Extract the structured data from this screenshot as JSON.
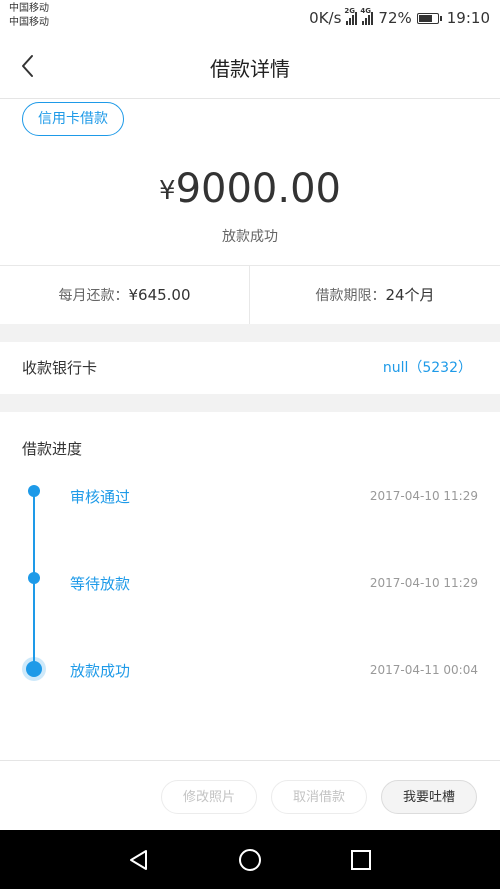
{
  "status_bar": {
    "carrier_1": "中国移动",
    "carrier_2": "中国移动",
    "net_speed": "0K/s",
    "network_1": "2G",
    "network_2": "4G",
    "battery": "72%",
    "battery_level": 0.72,
    "time": "19:10"
  },
  "nav": {
    "title": "借款详情"
  },
  "loan": {
    "tag": "信用卡借款",
    "currency": "¥",
    "amount": "9000.00",
    "status": "放款成功",
    "monthly_label": "每月还款：",
    "monthly_value": "¥645.00",
    "term_label": "借款期限：",
    "term_value": "24个月"
  },
  "bank": {
    "label": "收款银行卡",
    "value": "null（5232）"
  },
  "progress": {
    "title": "借款进度",
    "steps": [
      {
        "label": "审核通过",
        "time": "2017-04-10 11:29"
      },
      {
        "label": "等待放款",
        "time": "2017-04-10 11:29"
      },
      {
        "label": "放款成功",
        "time": "2017-04-11 00:04"
      }
    ]
  },
  "actions": {
    "edit_photo": "修改照片",
    "cancel_loan": "取消借款",
    "feedback": "我要吐槽"
  },
  "colors": {
    "accent": "#1e9ae8",
    "muted": "#999999",
    "divider": "#e8e8e8",
    "section_gap": "#f2f2f2"
  }
}
